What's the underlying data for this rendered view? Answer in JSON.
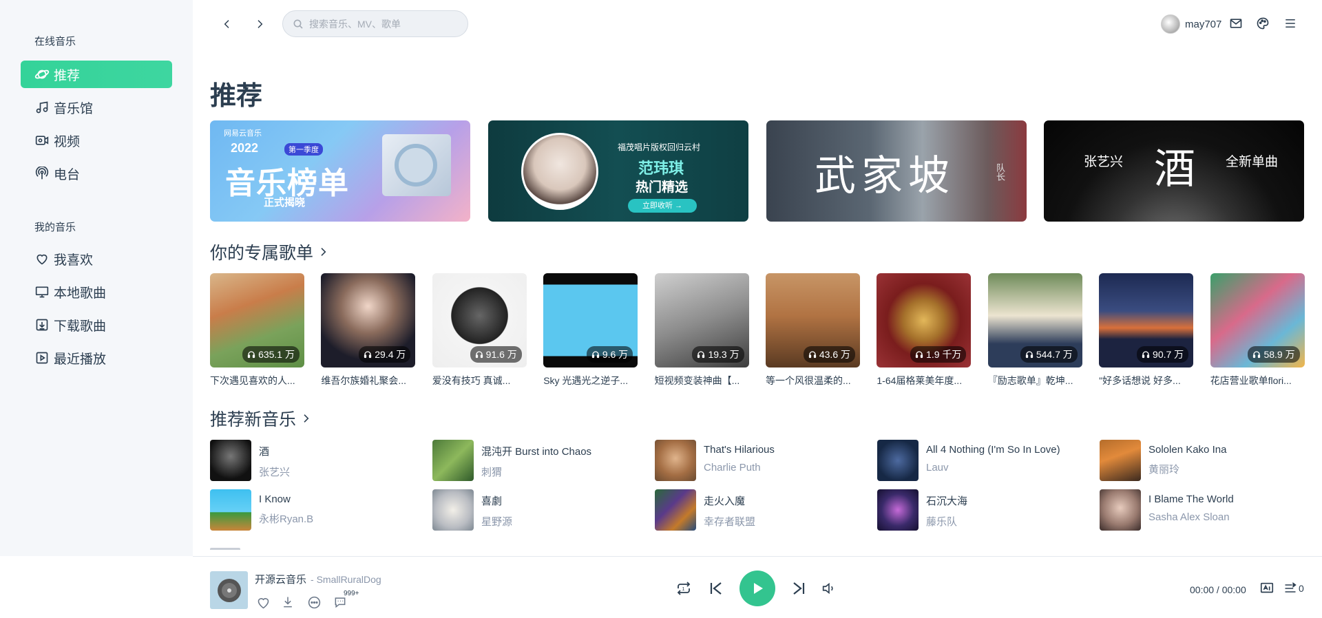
{
  "sidebar": {
    "online_title": "在线音乐",
    "online_items": [
      {
        "label": "推荐",
        "icon": "planet-icon"
      },
      {
        "label": "音乐馆",
        "icon": "music-note-icon"
      },
      {
        "label": "视频",
        "icon": "video-icon"
      },
      {
        "label": "电台",
        "icon": "radio-icon"
      }
    ],
    "my_title": "我的音乐",
    "my_items": [
      {
        "label": "我喜欢",
        "icon": "heart-icon"
      },
      {
        "label": "本地歌曲",
        "icon": "monitor-icon"
      },
      {
        "label": "下载歌曲",
        "icon": "download-icon"
      },
      {
        "label": "最近播放",
        "icon": "play-square-icon"
      }
    ]
  },
  "header": {
    "search_placeholder": "搜索音乐、MV、歌单",
    "username": "may707"
  },
  "main": {
    "title": "推荐",
    "playlists_heading": "你的专属歌单",
    "new_music_heading": "推荐新音乐",
    "playlists": [
      {
        "title": "下次遇见喜欢的人...",
        "plays": "635.1 万"
      },
      {
        "title": "维吾尔族婚礼聚会...",
        "plays": "29.4 万"
      },
      {
        "title": "爱没有技巧 真诚...",
        "plays": "91.6 万"
      },
      {
        "title": "Sky 光遇光之逆子...",
        "plays": "9.6 万"
      },
      {
        "title": "短视频变装神曲【...",
        "plays": "19.3 万"
      },
      {
        "title": "等一个风很温柔的...",
        "plays": "43.6 万"
      },
      {
        "title": "1-64届格莱美年度...",
        "plays": "1.9 千万"
      },
      {
        "title": "『励志歌单』乾坤...",
        "plays": "544.7 万"
      },
      {
        "title": "\"好多话想说 好多...",
        "plays": "90.7 万"
      },
      {
        "title": "花店营业歌单flori...",
        "plays": "58.9 万"
      }
    ],
    "songs": [
      {
        "name": "酒",
        "artist": "张艺兴"
      },
      {
        "name": "混沌开 Burst into Chaos",
        "artist": "刺猬"
      },
      {
        "name": "That's Hilarious",
        "artist": "Charlie Puth"
      },
      {
        "name": "All 4 Nothing (I'm So In Love)",
        "artist": "Lauv"
      },
      {
        "name": "Sololen Kako Ina",
        "artist": "黄丽玲"
      },
      {
        "name": "I Know",
        "artist": "永彬Ryan.B"
      },
      {
        "name": "喜劇",
        "artist": "星野源"
      },
      {
        "name": "走火入魔",
        "artist": "幸存者联盟"
      },
      {
        "name": "石沉大海",
        "artist": "藤乐队"
      },
      {
        "name": "I Blame The World",
        "artist": "Sasha Alex Sloan"
      }
    ],
    "banners": {
      "b1": {
        "brand": "网易云音乐",
        "year": "2022",
        "tag": "第一季度",
        "main": "音乐榜单",
        "sub": "正式揭晓"
      },
      "b2": {
        "line1": "福茂唱片版权回归云村",
        "name": "范玮琪",
        "sub": "热门精选",
        "btn": "立即收听 →"
      },
      "b3": {
        "title": "武家坡",
        "side": "队长"
      },
      "b4": {
        "left": "张艺兴",
        "center": "酒",
        "right": "全新单曲"
      }
    }
  },
  "player": {
    "title": "开源云音乐",
    "artist": "- SmallRuralDog",
    "comment_badge": "999+",
    "time": "00:00 / 00:00",
    "queue_count": "0"
  },
  "colors": {
    "accent": "#33c48f",
    "text": "#2c3e50",
    "muted": "#8b97ab"
  }
}
